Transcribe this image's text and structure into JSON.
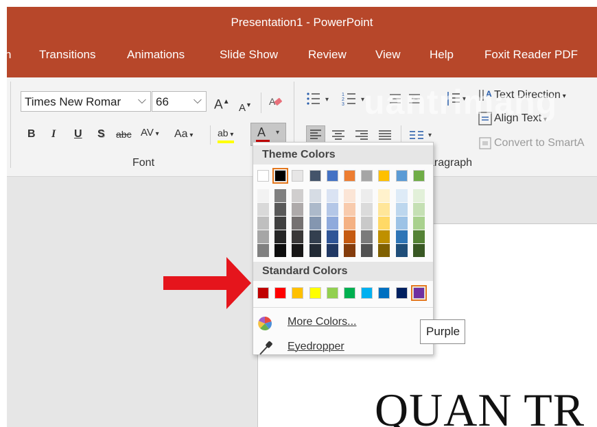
{
  "window": {
    "title": "Presentation1  -  PowerPoint"
  },
  "tabs": [
    {
      "label": "n"
    },
    {
      "label": "Transitions"
    },
    {
      "label": "Animations"
    },
    {
      "label": "Slide Show"
    },
    {
      "label": "Review"
    },
    {
      "label": "View"
    },
    {
      "label": "Help"
    },
    {
      "label": "Foxit Reader PDF"
    }
  ],
  "font_group": {
    "font_name": "Times New Romar",
    "font_size": "66",
    "grow_label": "A",
    "shrink_label": "A",
    "bold": "B",
    "italic": "I",
    "underline": "U",
    "shadow": "S",
    "strike": "abc",
    "spacing": "AV",
    "change_case": "Aa",
    "highlight": "ab",
    "font_color": "A",
    "label": "Font"
  },
  "paragraph_group": {
    "label": "aragraph",
    "text_direction": "Text Direction",
    "align_text": "Align Text",
    "convert_smartart": "Convert to SmartA"
  },
  "color_picker": {
    "theme_header": "Theme Colors",
    "standard_header": "Standard Colors",
    "theme_top": [
      "#ffffff",
      "#000000",
      "#e7e6e6",
      "#44546a",
      "#4472c4",
      "#ed7d31",
      "#a5a5a5",
      "#ffc000",
      "#5b9bd5",
      "#70ad47"
    ],
    "theme_shades": [
      [
        "#f2f2f2",
        "#d9d9d9",
        "#bfbfbf",
        "#a6a6a6",
        "#808080"
      ],
      [
        "#808080",
        "#595959",
        "#404040",
        "#262626",
        "#0d0d0d"
      ],
      [
        "#d0cece",
        "#aeaaaa",
        "#757171",
        "#3a3838",
        "#171616"
      ],
      [
        "#d6dce4",
        "#acb9ca",
        "#8496b0",
        "#333f4f",
        "#222a35"
      ],
      [
        "#dae3f3",
        "#b4c7e7",
        "#8faadc",
        "#2f5597",
        "#203864"
      ],
      [
        "#fbe5d6",
        "#f8cbad",
        "#f4b183",
        "#c55a11",
        "#843c0c"
      ],
      [
        "#ededed",
        "#dbdbdb",
        "#c9c9c9",
        "#7b7b7b",
        "#525252"
      ],
      [
        "#fff2cc",
        "#ffe699",
        "#ffd966",
        "#bf9000",
        "#7f6000"
      ],
      [
        "#deebf7",
        "#bdd7ee",
        "#9dc3e6",
        "#2e75b6",
        "#1f4e79"
      ],
      [
        "#e2f0d9",
        "#c5e0b4",
        "#a9d18e",
        "#548235",
        "#385723"
      ]
    ],
    "standard": [
      "#c00000",
      "#ff0000",
      "#ffc000",
      "#ffff00",
      "#92d050",
      "#00b050",
      "#00b0f0",
      "#0070c0",
      "#002060",
      "#7030a0"
    ],
    "more_colors": "More Colors...",
    "eyedropper": "Eyedropper"
  },
  "tooltip": "Purple",
  "slide": {
    "text": "QUAN  TR"
  },
  "watermark": "uantrimang",
  "accent": "#b7472a"
}
